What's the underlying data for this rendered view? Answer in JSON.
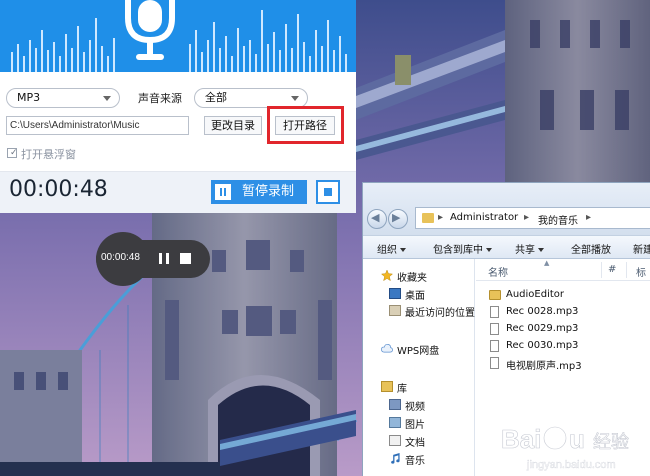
{
  "recorder": {
    "format_select": "MP3",
    "source_label": "声音来源",
    "source_select": "全部",
    "path_value": "C:\\Users\\Administrator\\Music",
    "change_dir_button": "更改目录",
    "open_path_button": "打开路径",
    "float_window_label": "打开悬浮窗",
    "elapsed_time": "00:00:48",
    "pause_record_button": "暂停录制",
    "accent_color": "#1f8fe8",
    "highlight_color": "#e1262c"
  },
  "mini_player": {
    "elapsed_time": "00:00:48"
  },
  "explorer": {
    "breadcrumbs": [
      "Administrator",
      "我的音乐"
    ],
    "toolbar": {
      "organize": "组织",
      "include_in_library": "包含到库中",
      "share": "共享",
      "play_all": "全部播放",
      "new_folder": "新建"
    },
    "nav": {
      "favorites": "收藏夹",
      "desktop": "桌面",
      "recent": "最近访问的位置",
      "wps": "WPS网盘",
      "libraries": "库",
      "videos": "视频",
      "pictures": "图片",
      "documents": "文档",
      "music": "音乐"
    },
    "columns": {
      "name": "名称",
      "number": "#",
      "title": "标"
    },
    "files": [
      {
        "name": "AudioEditor",
        "type": "folder"
      },
      {
        "name": "Rec 0028.mp3",
        "type": "file"
      },
      {
        "name": "Rec 0029.mp3",
        "type": "file"
      },
      {
        "name": "Rec 0030.mp3",
        "type": "file"
      },
      {
        "name": "电视剧原声.mp3",
        "type": "file"
      }
    ]
  },
  "watermark": {
    "brand": "Baidu",
    "site": "jingyan.baidu.com",
    "suffix": "经验"
  }
}
